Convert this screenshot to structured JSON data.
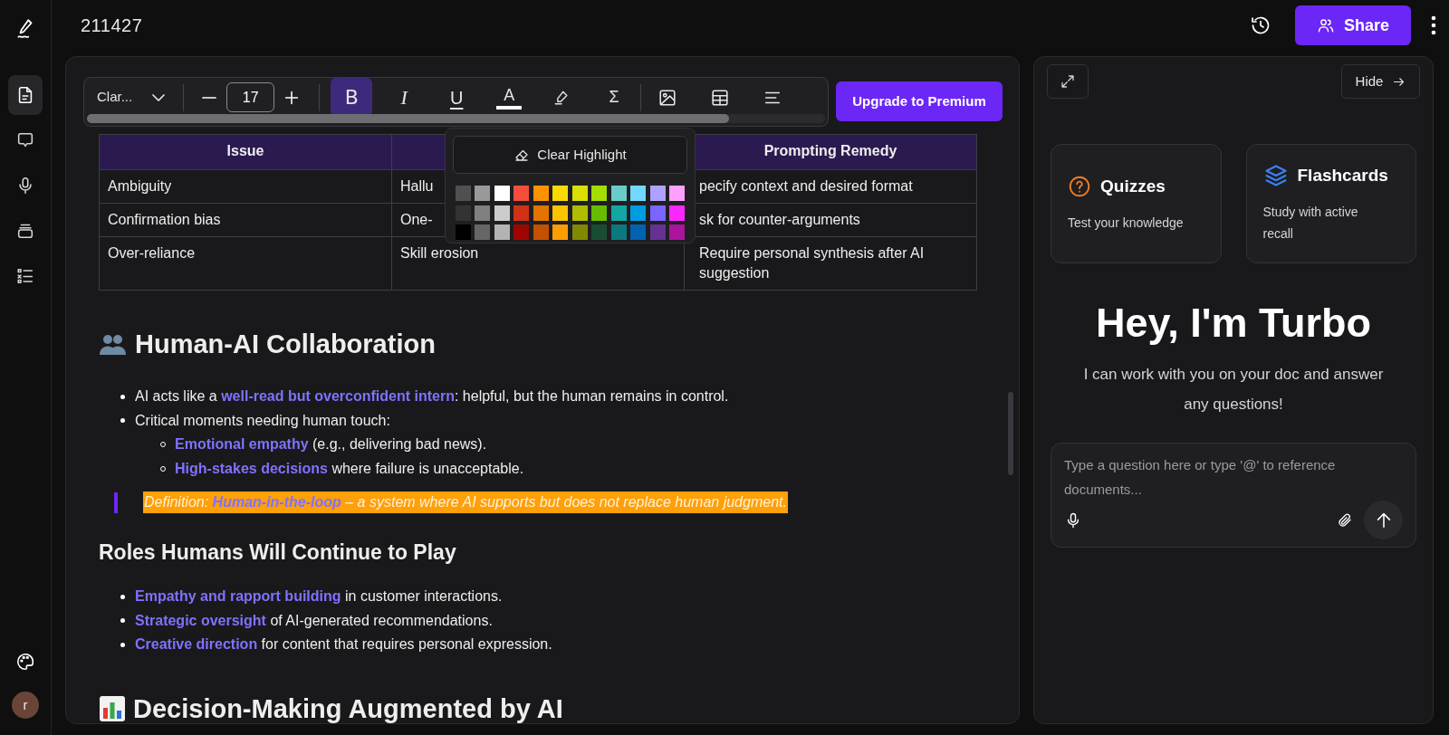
{
  "document_title": "211427",
  "rail": {
    "items": [
      {
        "kind": "document",
        "selected": true
      },
      {
        "kind": "comment",
        "selected": false
      },
      {
        "kind": "mic",
        "selected": false
      },
      {
        "kind": "stack",
        "selected": false
      },
      {
        "kind": "checklist",
        "selected": false
      }
    ],
    "avatar": "r"
  },
  "header": {
    "share": "Share"
  },
  "toolbar": {
    "font": "Clar...",
    "font_size": "17",
    "tools": [
      {
        "kind": "bold",
        "glyph": "B",
        "active": true
      },
      {
        "kind": "italic",
        "glyph": "I",
        "active": false
      },
      {
        "kind": "underline",
        "glyph": "U",
        "active": false
      },
      {
        "kind": "text_color",
        "glyph": "A",
        "active": false
      },
      {
        "kind": "highlight",
        "active": false
      },
      {
        "kind": "formula",
        "glyph": "Σ",
        "active": false
      },
      {
        "kind": "image",
        "active": false
      },
      {
        "kind": "table",
        "active": false
      },
      {
        "kind": "align",
        "active": false
      }
    ]
  },
  "upgrade": "Upgrade to Premium",
  "highlight_popup": {
    "clear": "Clear Highlight",
    "swatches": [
      {
        "color": "#505050"
      },
      {
        "color": "#999999"
      },
      {
        "color": "#ffffff"
      },
      {
        "color": "#f44e3b"
      },
      {
        "color": "#fe9200"
      },
      {
        "color": "#fcdc00"
      },
      {
        "color": "#dbdf00"
      },
      {
        "color": "#a4dd00"
      },
      {
        "color": "#68ccca"
      },
      {
        "color": "#73d8ff"
      },
      {
        "color": "#aea1ff"
      },
      {
        "color": "#fda1ff"
      },
      {
        "color": "#333333"
      },
      {
        "color": "#808080"
      },
      {
        "color": "#cccccc"
      },
      {
        "color": "#d33115"
      },
      {
        "color": "#e27300"
      },
      {
        "color": "#fcc400"
      },
      {
        "color": "#b0bc00"
      },
      {
        "color": "#68bc00"
      },
      {
        "color": "#16a5a5"
      },
      {
        "color": "#009ce0"
      },
      {
        "color": "#7b64ff"
      },
      {
        "color": "#fa28ff"
      },
      {
        "color": "#000000"
      },
      {
        "color": "#666666"
      },
      {
        "color": "#b3b3b3"
      },
      {
        "color": "#9f0500"
      },
      {
        "color": "#c45100"
      },
      {
        "color": "#fb9e00"
      },
      {
        "color": "#808900"
      },
      {
        "color": "#194d33"
      },
      {
        "color": "#0c797d"
      },
      {
        "color": "#0062b1"
      },
      {
        "color": "#653294"
      },
      {
        "color": "#ab149e"
      }
    ]
  },
  "table": {
    "header": {
      "column_1": "Issue",
      "column_3": "Prompting Remedy"
    },
    "rows": [
      {
        "column_1": "Ambiguity",
        "column_2": "Hallu",
        "column_3": "pecify context and desired format"
      },
      {
        "column_1": "Confirmation bias",
        "column_2": "One-",
        "column_3": "sk for counter-arguments"
      },
      {
        "column_1": "Over-reliance",
        "column_2": "Skill erosion",
        "column_3": "Require personal synthesis after AI suggestion"
      }
    ]
  },
  "blocks": [
    {
      "kind": "heading",
      "text": "Human-AI Collaboration"
    },
    {
      "kind": "list",
      "items": [
        {
          "text": "AI acts like a **well-read but overconfident intern**: helpful, but the human remains in control."
        },
        {
          "text": "Critical moments needing human touch:",
          "children": [
            {
              "text": "**Emotional empathy** (e.g., delivering bad news)."
            },
            {
              "text": "**High-stakes decisions** where failure is unacceptable."
            }
          ]
        }
      ]
    },
    {
      "kind": "quote",
      "text": "Definition: **Human-in-the-loop** – a system where AI supports but does not replace human judgment."
    },
    {
      "kind": "subheading",
      "text": "Roles Humans Will Continue to Play"
    },
    {
      "kind": "list",
      "items": [
        {
          "text": "**Empathy and rapport building** in customer interactions."
        },
        {
          "text": "**Strategic oversight** of AI-generated recommendations."
        },
        {
          "text": "**Creative direction** for content that requires personal expression."
        }
      ]
    },
    {
      "kind": "heading",
      "text": "Decision-Making Augmented by AI"
    }
  ],
  "assistant": {
    "hide": "Hide",
    "cards": [
      {
        "kind": "quiz",
        "title": "Quizzes",
        "subtitle": "Test your knowledge"
      },
      {
        "kind": "flashcards",
        "title": "Flashcards",
        "subtitle": "Study with active recall"
      }
    ],
    "greeting": "Hey, I'm Turbo",
    "intro": "I can work with you on your doc and answer any questions!",
    "input": {
      "placeholder": "Type a question here or type '@' to reference documents..."
    }
  }
}
